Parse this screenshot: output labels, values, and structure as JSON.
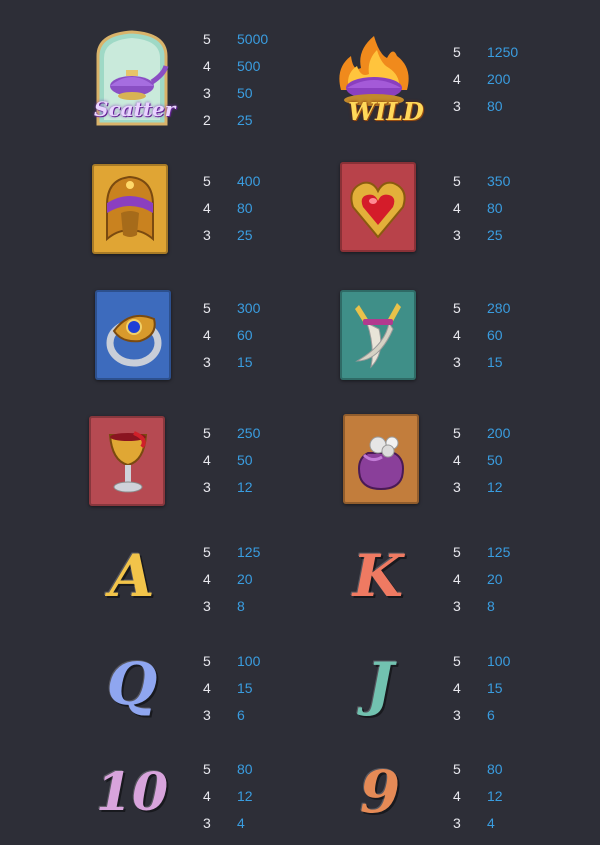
{
  "symbols": [
    {
      "id": "scatter",
      "label": "Scatter",
      "pays": [
        {
          "count": "5",
          "value": "5000"
        },
        {
          "count": "4",
          "value": "500"
        },
        {
          "count": "3",
          "value": "50"
        },
        {
          "count": "2",
          "value": "25"
        }
      ]
    },
    {
      "id": "wild",
      "label": "WILD",
      "pays": [
        {
          "count": "5",
          "value": "1250"
        },
        {
          "count": "4",
          "value": "200"
        },
        {
          "count": "3",
          "value": "80"
        }
      ]
    },
    {
      "id": "helmet",
      "pays": [
        {
          "count": "5",
          "value": "400"
        },
        {
          "count": "4",
          "value": "80"
        },
        {
          "count": "3",
          "value": "25"
        }
      ]
    },
    {
      "id": "heart-gem",
      "pays": [
        {
          "count": "5",
          "value": "350"
        },
        {
          "count": "4",
          "value": "80"
        },
        {
          "count": "3",
          "value": "25"
        }
      ]
    },
    {
      "id": "ring",
      "pays": [
        {
          "count": "5",
          "value": "300"
        },
        {
          "count": "4",
          "value": "60"
        },
        {
          "count": "3",
          "value": "15"
        }
      ]
    },
    {
      "id": "daggers",
      "pays": [
        {
          "count": "5",
          "value": "280"
        },
        {
          "count": "4",
          "value": "60"
        },
        {
          "count": "3",
          "value": "15"
        }
      ]
    },
    {
      "id": "goblet",
      "pays": [
        {
          "count": "5",
          "value": "250"
        },
        {
          "count": "4",
          "value": "50"
        },
        {
          "count": "3",
          "value": "12"
        }
      ]
    },
    {
      "id": "pouch",
      "pays": [
        {
          "count": "5",
          "value": "200"
        },
        {
          "count": "4",
          "value": "50"
        },
        {
          "count": "3",
          "value": "12"
        }
      ]
    },
    {
      "id": "A",
      "label": "A",
      "pays": [
        {
          "count": "5",
          "value": "125"
        },
        {
          "count": "4",
          "value": "20"
        },
        {
          "count": "3",
          "value": "8"
        }
      ]
    },
    {
      "id": "K",
      "label": "K",
      "pays": [
        {
          "count": "5",
          "value": "125"
        },
        {
          "count": "4",
          "value": "20"
        },
        {
          "count": "3",
          "value": "8"
        }
      ]
    },
    {
      "id": "Q",
      "label": "Q",
      "pays": [
        {
          "count": "5",
          "value": "100"
        },
        {
          "count": "4",
          "value": "15"
        },
        {
          "count": "3",
          "value": "6"
        }
      ]
    },
    {
      "id": "J",
      "label": "J",
      "pays": [
        {
          "count": "5",
          "value": "100"
        },
        {
          "count": "4",
          "value": "15"
        },
        {
          "count": "3",
          "value": "6"
        }
      ]
    },
    {
      "id": "10",
      "label": "10",
      "pays": [
        {
          "count": "5",
          "value": "80"
        },
        {
          "count": "4",
          "value": "12"
        },
        {
          "count": "3",
          "value": "4"
        }
      ]
    },
    {
      "id": "9",
      "label": "9",
      "pays": [
        {
          "count": "5",
          "value": "80"
        },
        {
          "count": "4",
          "value": "12"
        },
        {
          "count": "3",
          "value": "4"
        }
      ]
    }
  ],
  "colors": {
    "background": "#2d2e37",
    "count_text": "#e8e8ee",
    "value_text": "#3a9de0"
  }
}
